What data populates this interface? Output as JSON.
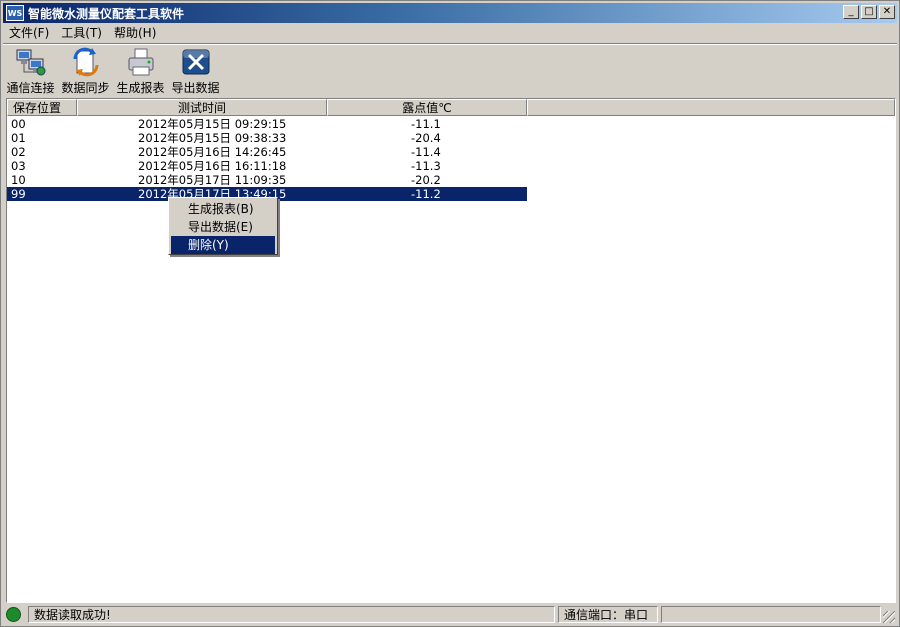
{
  "window": {
    "title": "智能微水测量仪配套工具软件",
    "icon_text": "WS",
    "minimize": "_",
    "maximize": "□",
    "close": "✕"
  },
  "menu": [
    "文件(F)",
    "工具(T)",
    "帮助(H)"
  ],
  "toolbar": [
    {
      "label": "通信连接",
      "icon": "network-computers-icon"
    },
    {
      "label": "数据同步",
      "icon": "sync-icon"
    },
    {
      "label": "生成报表",
      "icon": "printer-icon"
    },
    {
      "label": "导出数据",
      "icon": "excel-export-icon"
    }
  ],
  "table": {
    "columns": [
      "保存位置",
      "测试时间",
      "露点值℃"
    ],
    "rows": [
      {
        "pos": "00",
        "time": "2012年05月15日 09:29:15",
        "value": "-11.1"
      },
      {
        "pos": "01",
        "time": "2012年05月15日 09:38:33",
        "value": "-20.4"
      },
      {
        "pos": "02",
        "time": "2012年05月16日 14:26:45",
        "value": "-11.4"
      },
      {
        "pos": "03",
        "time": "2012年05月16日 16:11:18",
        "value": "-11.3"
      },
      {
        "pos": "10",
        "time": "2012年05月17日 11:09:35",
        "value": "-20.2"
      },
      {
        "pos": "99",
        "time": "2012年05月17日 13:49:15",
        "value": "-11.2"
      }
    ],
    "selected_row": 5
  },
  "context_menu": [
    "生成报表(B)",
    "导出数据(E)",
    "删除(Y)"
  ],
  "statusbar": {
    "message": "数据读取成功!",
    "port": "通信端口：串口"
  },
  "colors": {
    "selection": "#0a246a",
    "status_led": "#1d8a2e"
  }
}
